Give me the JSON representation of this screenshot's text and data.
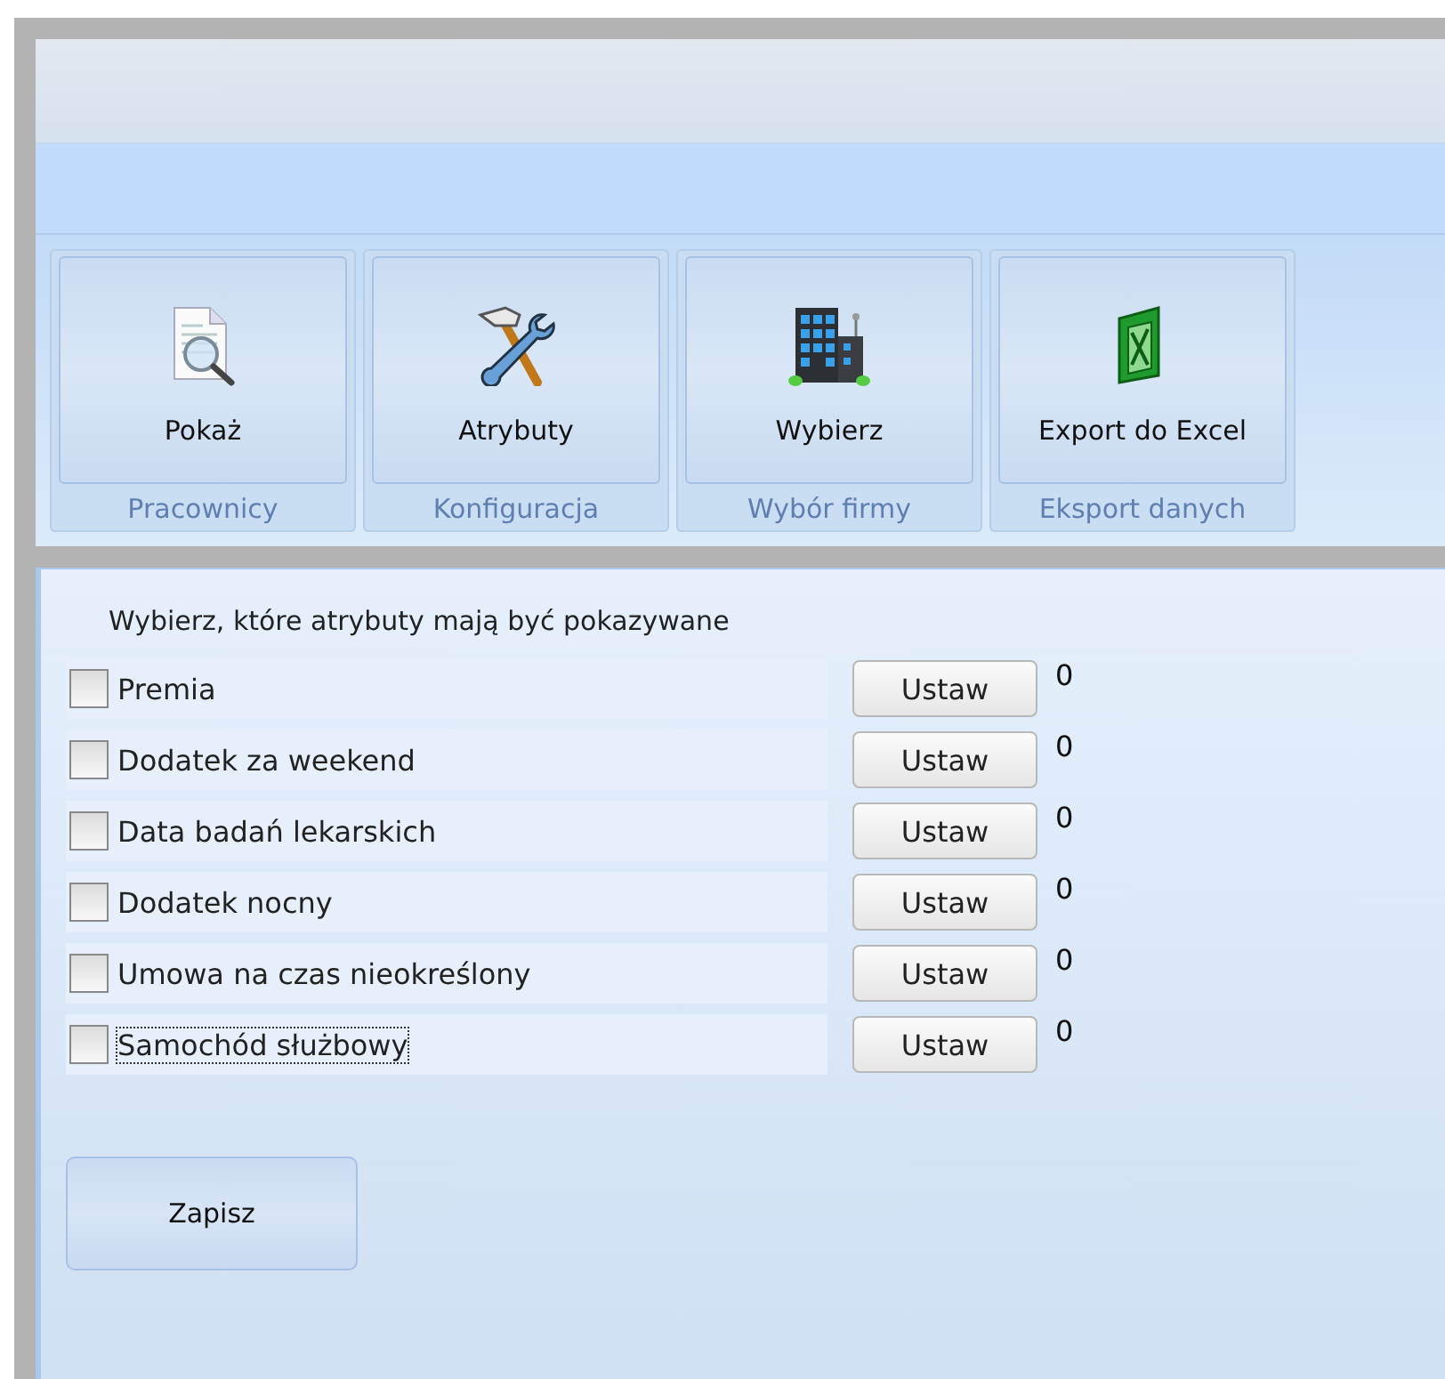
{
  "ribbon": {
    "groups": [
      {
        "button": "Pokaż",
        "label": "Pracownicy"
      },
      {
        "button": "Atrybuty",
        "label": "Konfiguracja"
      },
      {
        "button": "Wybierz",
        "label": "Wybór firmy"
      },
      {
        "button": "Export do Excel",
        "label": "Eksport danych"
      }
    ]
  },
  "panel": {
    "heading": "Wybierz, które atrybuty mają być pokazywane",
    "attributes": [
      {
        "label": "Premia",
        "checked": false,
        "focused": false,
        "button": "Ustaw",
        "value": "0"
      },
      {
        "label": "Dodatek za weekend",
        "checked": false,
        "focused": false,
        "button": "Ustaw",
        "value": "0"
      },
      {
        "label": "Data badań lekarskich",
        "checked": false,
        "focused": false,
        "button": "Ustaw",
        "value": "0"
      },
      {
        "label": "Dodatek nocny",
        "checked": false,
        "focused": false,
        "button": "Ustaw",
        "value": "0"
      },
      {
        "label": "Umowa na czas nieokreślony",
        "checked": false,
        "focused": false,
        "button": "Ustaw",
        "value": "0"
      },
      {
        "label": "Samochód służbowy",
        "checked": false,
        "focused": true,
        "button": "Ustaw",
        "value": "0"
      }
    ],
    "save_button": "Zapisz"
  }
}
